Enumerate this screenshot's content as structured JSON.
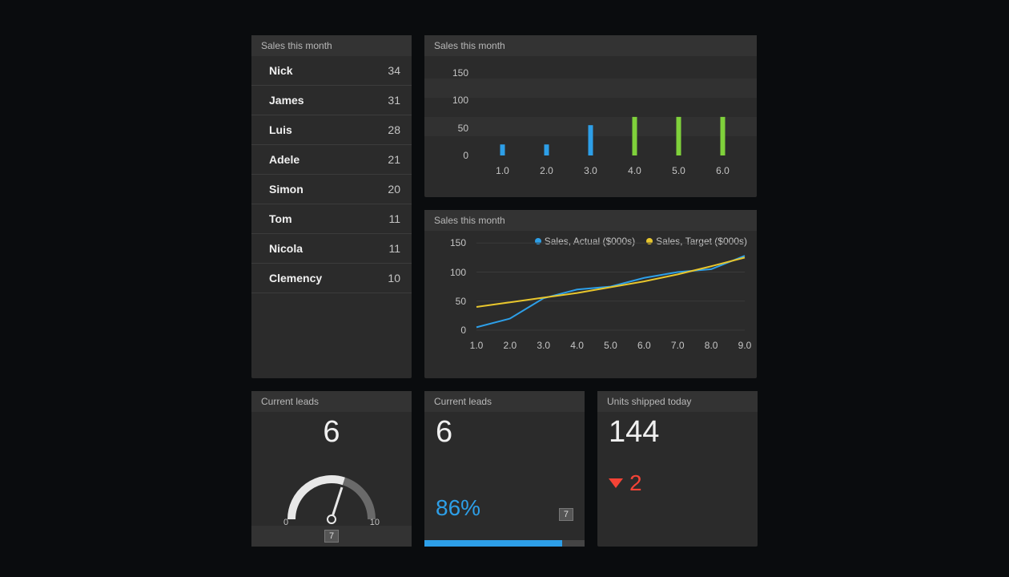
{
  "list_card": {
    "title": "Sales this month",
    "rows": [
      {
        "name": "Nick",
        "value": 34
      },
      {
        "name": "James",
        "value": 31
      },
      {
        "name": "Luis",
        "value": 28
      },
      {
        "name": "Adele",
        "value": 21
      },
      {
        "name": "Simon",
        "value": 20
      },
      {
        "name": "Tom",
        "value": 11
      },
      {
        "name": "Nicola",
        "value": 11
      },
      {
        "name": "Clemency",
        "value": 10
      }
    ]
  },
  "chart_data": [
    {
      "type": "bar",
      "title_header": "Sales this month",
      "categories": [
        "1.0",
        "2.0",
        "3.0",
        "4.0",
        "5.0",
        "6.0"
      ],
      "values": [
        20,
        20,
        55,
        70,
        70,
        70
      ],
      "yticks": [
        0,
        50,
        100,
        150
      ],
      "colors": [
        "#2d9fe8",
        "#2d9fe8",
        "#2d9fe8",
        "#7fd13b",
        "#7fd13b",
        "#7fd13b"
      ],
      "ylim": [
        0,
        160
      ]
    },
    {
      "type": "line",
      "title_header": "Sales this month",
      "x": [
        "1.0",
        "2.0",
        "3.0",
        "4.0",
        "5.0",
        "6.0",
        "7.0",
        "8.0",
        "9.0"
      ],
      "series": [
        {
          "name": "Sales, Actual ($000s)",
          "color": "#2d9fe8",
          "values": [
            5,
            20,
            55,
            70,
            75,
            90,
            100,
            105,
            128
          ]
        },
        {
          "name": "Sales, Target ($000s)",
          "color": "#e8c62d",
          "values": [
            40,
            48,
            56,
            64,
            74,
            84,
            96,
            110,
            125
          ]
        }
      ],
      "yticks": [
        0,
        50,
        100,
        150
      ],
      "ylim": [
        0,
        160
      ]
    }
  ],
  "gauge": {
    "title": "Current leads",
    "value": 6,
    "min": 0,
    "max": 10,
    "badge": "7"
  },
  "leads_pct": {
    "title": "Current leads",
    "value": 6,
    "percent": "86%",
    "percent_num": 86,
    "badge": "7"
  },
  "units": {
    "title": "Units shipped today",
    "value": 144,
    "delta": 2
  }
}
